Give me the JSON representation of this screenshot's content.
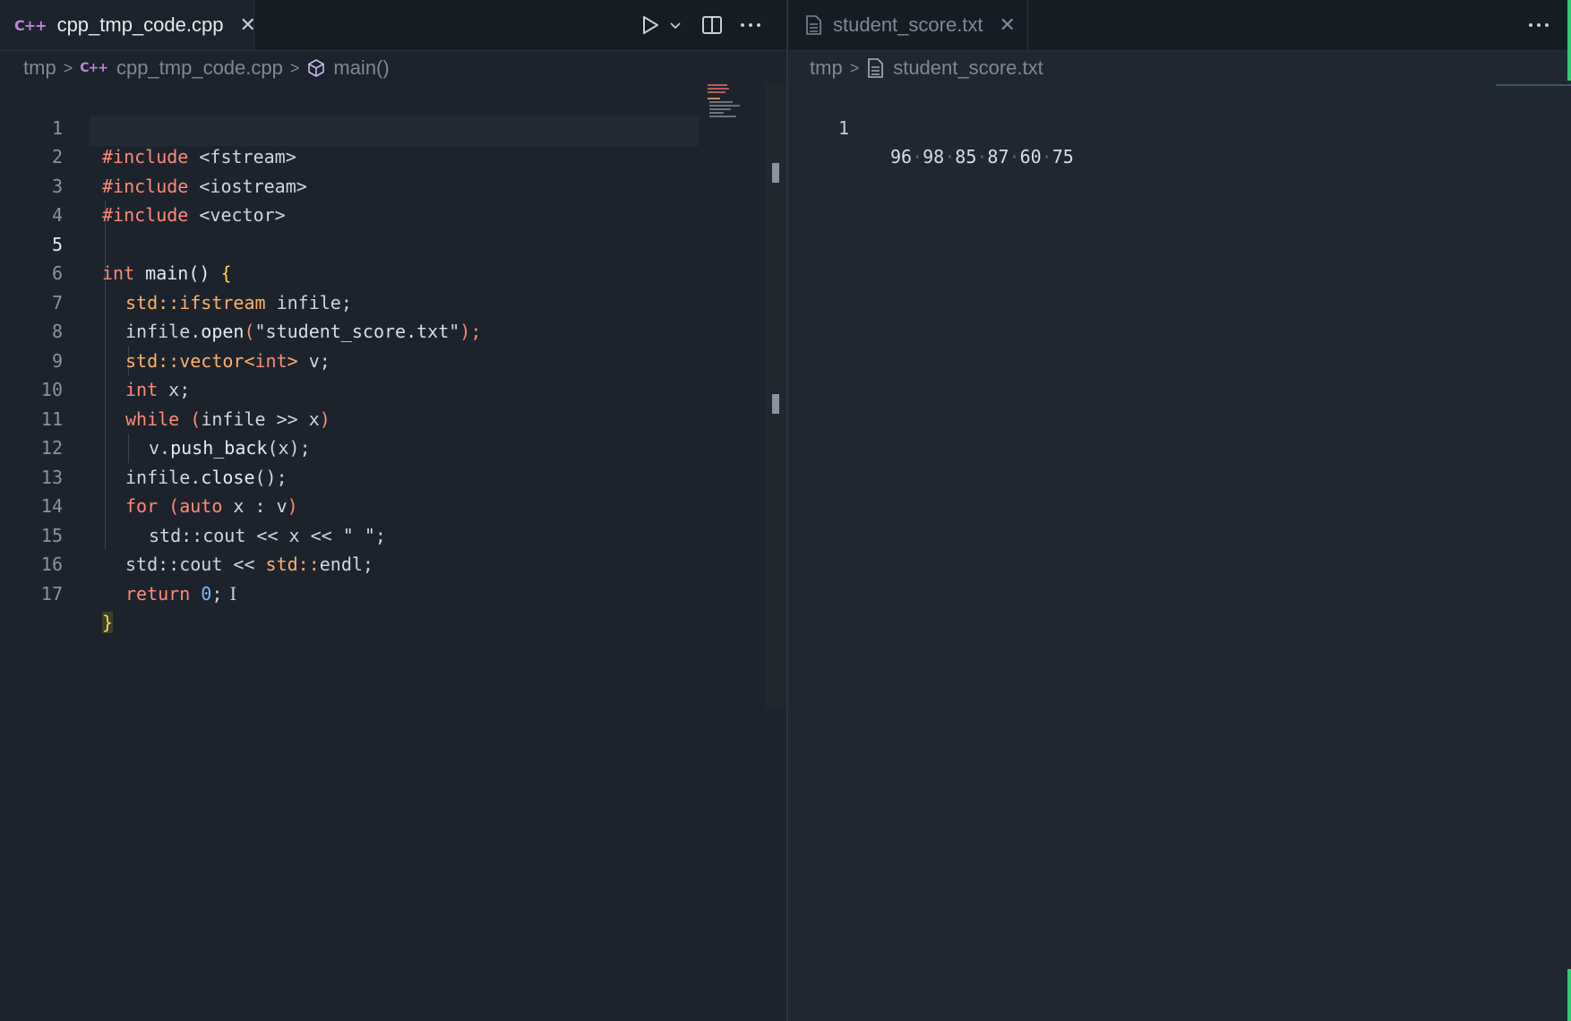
{
  "left_editor": {
    "tab": {
      "label": "cpp_tmp_code.cpp",
      "icon": "cpp-file-icon",
      "close_label": "✕"
    },
    "breadcrumb": {
      "folder": "tmp",
      "file": "cpp_tmp_code.cpp",
      "symbol": "main()"
    },
    "toolbar": {
      "run": "run-icon",
      "run_menu": "chevron-down-icon",
      "split": "split-editor-icon",
      "more": "more-actions-icon"
    },
    "current_line": 5,
    "lines": [
      {
        "n": "1"
      },
      {
        "n": "2"
      },
      {
        "n": "3"
      },
      {
        "n": "4"
      },
      {
        "n": "5"
      },
      {
        "n": "6"
      },
      {
        "n": "7"
      },
      {
        "n": "8"
      },
      {
        "n": "9"
      },
      {
        "n": "10"
      },
      {
        "n": "11"
      },
      {
        "n": "12"
      },
      {
        "n": "13"
      },
      {
        "n": "14"
      },
      {
        "n": "15"
      },
      {
        "n": "16"
      },
      {
        "n": "17"
      }
    ],
    "tokens": {
      "l1": [
        "#include",
        " <fstream>"
      ],
      "l2": [
        "#include",
        " <iostream>"
      ],
      "l3": [
        "#include",
        " <vector>"
      ],
      "l5": [
        "int",
        " main() ",
        "{"
      ],
      "l6": [
        "std::",
        "ifstream",
        " infile;"
      ],
      "l7": [
        "infile.",
        "open",
        "(",
        "\"student_score.txt\"",
        ");"
      ],
      "l8": [
        "std::",
        "vector",
        "<",
        "int",
        ">",
        " v;"
      ],
      "l9": [
        "int",
        " x;"
      ],
      "l10": [
        "while",
        " (",
        "infile >> x",
        ")"
      ],
      "l11": [
        "v.",
        "push_back",
        "(x);"
      ],
      "l12": [
        "infile.",
        "close",
        "();"
      ],
      "l13": [
        "for",
        " (",
        "auto",
        " x : v",
        ")"
      ],
      "l14": [
        "std::cout << x << ",
        "\" \"",
        ";"
      ],
      "l15": [
        "std::cout << ",
        "std::",
        "endl;"
      ],
      "l16": [
        "return",
        " ",
        "0",
        ";"
      ],
      "l17": [
        "}"
      ]
    }
  },
  "right_editor": {
    "tab": {
      "label": "student_score.txt",
      "icon": "text-file-icon",
      "close_label": "✕"
    },
    "breadcrumb": {
      "folder": "tmp",
      "file": "student_score.txt"
    },
    "more": "more-actions-icon",
    "lines": [
      {
        "n": "1",
        "values": [
          "96",
          "98",
          "85",
          "87",
          "60",
          "75"
        ]
      }
    ]
  },
  "colors": {
    "keyword": "#ff8a7a",
    "type": "#ffb068",
    "number": "#7fb6ff",
    "bracket": "#ffd54a",
    "accent": "#2ecc71"
  }
}
